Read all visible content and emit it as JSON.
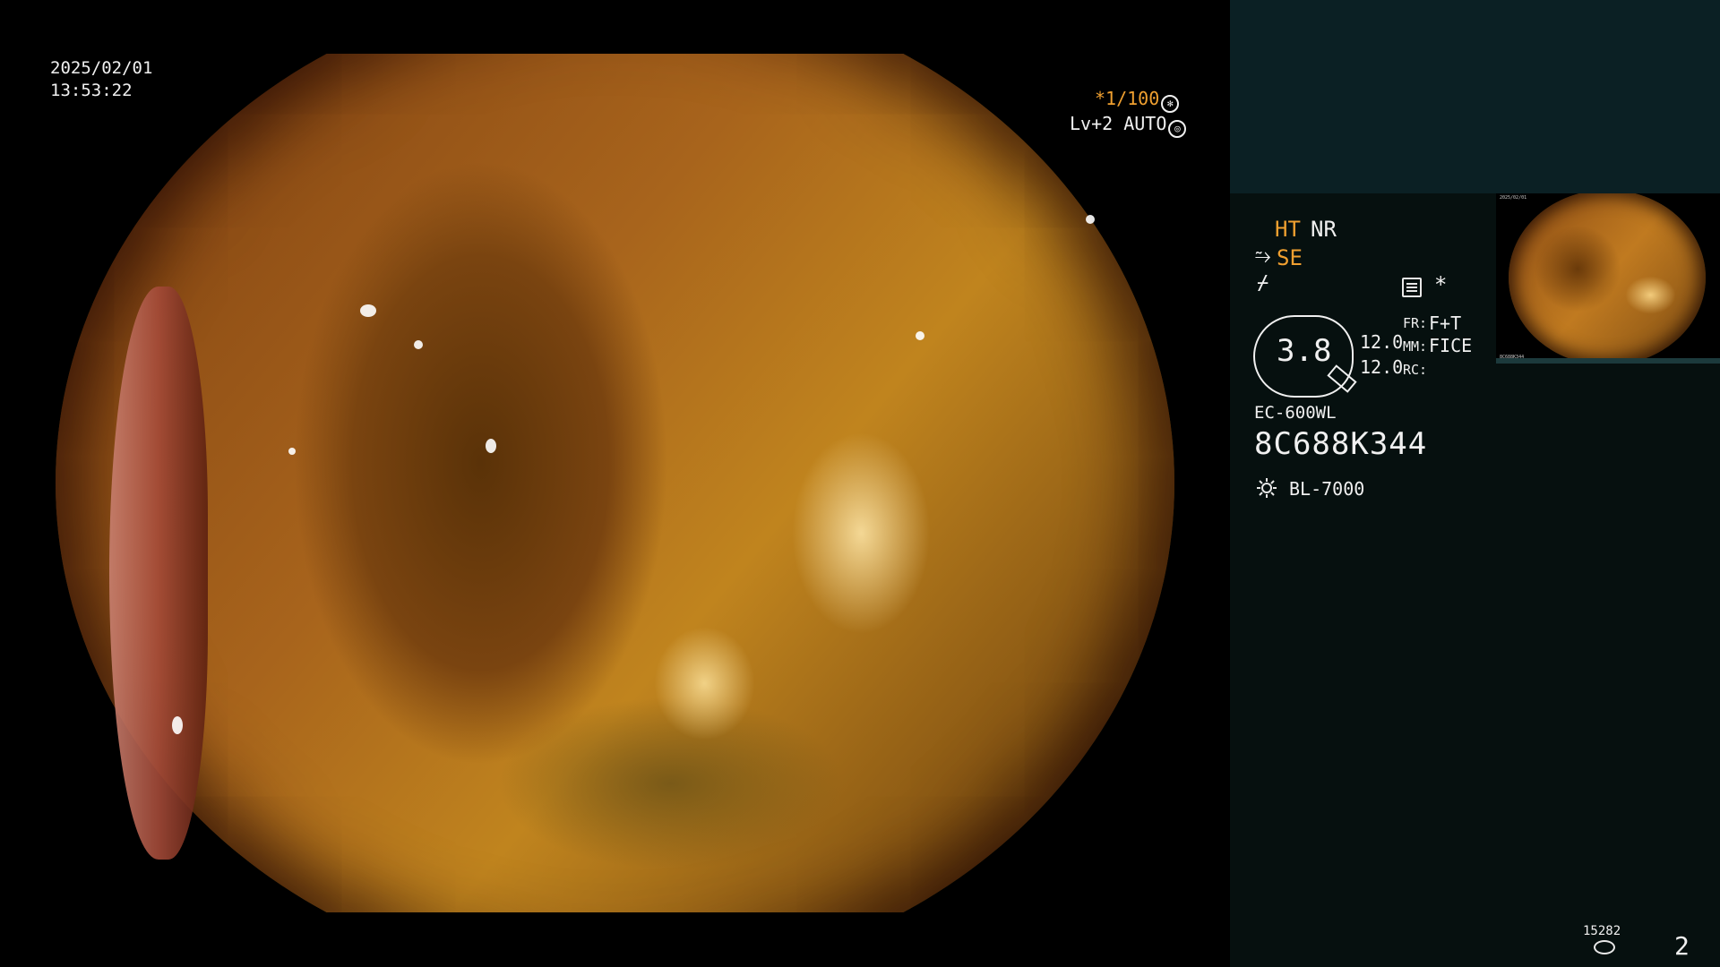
{
  "overlay": {
    "date": "2025/02/01",
    "time": "13:53:22",
    "shutter": "*1/100",
    "shutter_icon": "shutter-icon",
    "level": "Lv+2 AUTO",
    "level_icon": "iris-icon"
  },
  "settings": {
    "ht": "HT",
    "nr": "NR",
    "se": "SE",
    "se_icon": "structure-enhance-icon",
    "f_icon_glyph": "⌿",
    "menu_icon": "menu-icon",
    "asterisk": "*",
    "zoom": "3.8",
    "value_1": "12.0",
    "value_2": "12.0",
    "fr_label": "FR:",
    "fr_value": "F+T",
    "mm_label": "MM:",
    "mm_value": "FICE",
    "rc_label": "RC:",
    "rc_value": ""
  },
  "device": {
    "model": "EC-600WL",
    "serial": "8C688K344",
    "light_icon": "sun-icon",
    "light_source": "BL-7000"
  },
  "footer": {
    "counter": "15282",
    "counter_icon": "disk-icon",
    "page": "2"
  },
  "colors": {
    "accent_orange": "#f0a030",
    "panel_teal": "#0b2024",
    "panel_dark": "#06100f"
  }
}
